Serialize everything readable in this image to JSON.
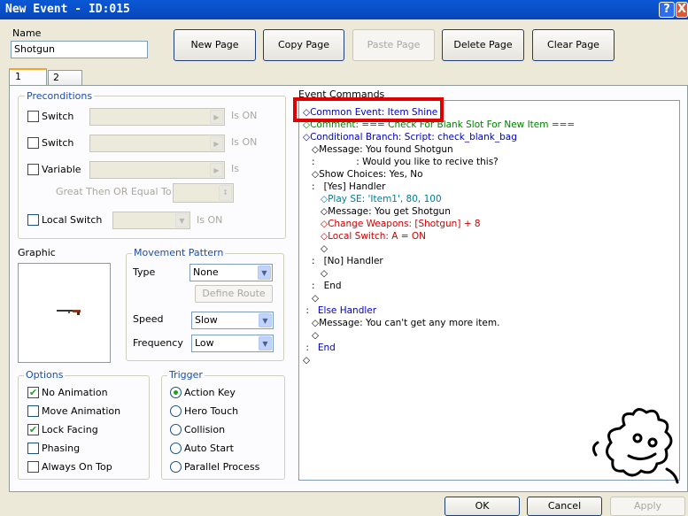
{
  "window": {
    "title": "New Event - ID:015",
    "help_glyph": "?",
    "close_glyph": "X"
  },
  "name": {
    "label": "Name",
    "value": "Shotgun"
  },
  "toolbar": {
    "new_page": "New Page",
    "copy_page": "Copy Page",
    "paste_page": "Paste Page",
    "delete_page": "Delete Page",
    "clear_page": "Clear Page"
  },
  "tabs": [
    {
      "label": "1"
    },
    {
      "label": "2"
    }
  ],
  "preconditions": {
    "legend": "Preconditions",
    "switch1": {
      "label": "Switch",
      "suffix": "Is ON"
    },
    "switch2": {
      "label": "Switch",
      "suffix": "Is ON"
    },
    "variable": {
      "label": "Variable",
      "suffix": "Is"
    },
    "great_then": "Great Then OR Equal To",
    "local_switch": {
      "label": "Local Switch",
      "suffix": "Is ON"
    }
  },
  "graphic": {
    "label": "Graphic"
  },
  "movement": {
    "legend": "Movement Pattern",
    "type_label": "Type",
    "type_value": "None",
    "define_route": "Define Route",
    "speed_label": "Speed",
    "speed_value": "Slow",
    "frequency_label": "Frequency",
    "frequency_value": "Low"
  },
  "options": {
    "legend": "Options",
    "items": [
      {
        "label": "No Animation",
        "checked": true
      },
      {
        "label": "Move Animation",
        "checked": false
      },
      {
        "label": "Lock Facing",
        "checked": true
      },
      {
        "label": "Phasing",
        "checked": false
      },
      {
        "label": "Always On Top",
        "checked": false
      }
    ]
  },
  "trigger": {
    "legend": "Trigger",
    "items": [
      {
        "label": "Action Key",
        "selected": true
      },
      {
        "label": "Hero Touch",
        "selected": false
      },
      {
        "label": "Collision",
        "selected": false
      },
      {
        "label": "Auto Start",
        "selected": false
      },
      {
        "label": "Parallel Process",
        "selected": false
      }
    ]
  },
  "event_commands": {
    "label": "Event Commands",
    "lines": [
      {
        "text": "◇Common Event: Item Shine",
        "color": "blue"
      },
      {
        "text": "◇Comment: === Check For Blank Slot For New Item ===",
        "color": "green"
      },
      {
        "text": "◇Conditional Branch: Script: check_blank_bag",
        "color": "blue"
      },
      {
        "text": "   ◇Message: You found Shotgun",
        "color": "black"
      },
      {
        "text": "   :              : Would you like to recive this?",
        "color": "black"
      },
      {
        "text": "   ◇Show Choices: Yes, No",
        "color": "black"
      },
      {
        "text": "   :   [Yes] Handler",
        "color": "black"
      },
      {
        "text": "      ◇Play SE: 'Item1', 80, 100",
        "color": "teal"
      },
      {
        "text": "      ◇Message: You get Shotgun",
        "color": "black"
      },
      {
        "text": "      ◇Change Weapons: [Shotgun] + 8",
        "color": "red"
      },
      {
        "text": "      ◇Local Switch: A = ON",
        "color": "red"
      },
      {
        "text": "      ◇",
        "color": "black"
      },
      {
        "text": "   :   [No] Handler",
        "color": "black"
      },
      {
        "text": "      ◇",
        "color": "black"
      },
      {
        "text": "   :   End",
        "color": "black"
      },
      {
        "text": "   ◇",
        "color": "black"
      },
      {
        "text": " :   Else Handler",
        "color": "blue"
      },
      {
        "text": "   ◇Message: You can't get any more item.",
        "color": "black"
      },
      {
        "text": "   ◇",
        "color": "black"
      },
      {
        "text": " :   End",
        "color": "blue"
      },
      {
        "text": "◇",
        "color": "black"
      }
    ]
  },
  "footer": {
    "ok": "OK",
    "cancel": "Cancel",
    "apply": "Apply"
  },
  "highlight_color": "#e00000"
}
